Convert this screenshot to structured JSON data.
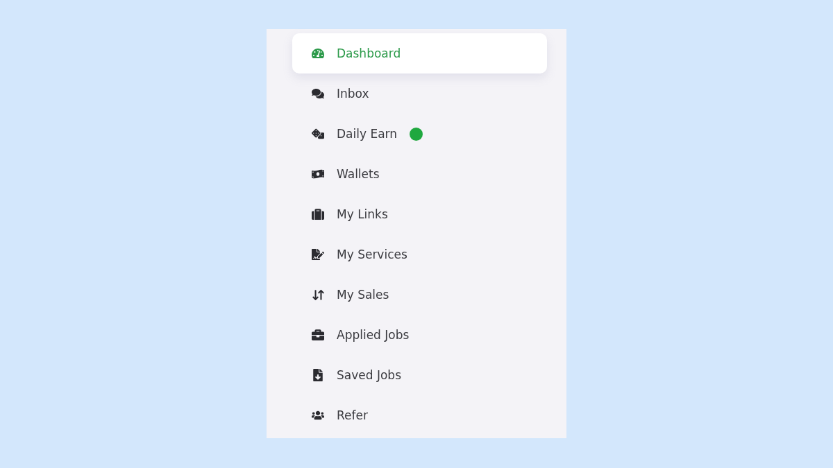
{
  "sidebar": {
    "items": [
      {
        "label": "Dashboard",
        "selected": true
      },
      {
        "label": "Inbox",
        "selected": false
      },
      {
        "label": "Daily Earn",
        "selected": false,
        "color": "#1fa83f"
      },
      {
        "label": "Wallets",
        "selected": false
      },
      {
        "label": "My Links",
        "selected": false
      },
      {
        "label": "My Services",
        "selected": false
      },
      {
        "label": "My Sales",
        "selected": false
      },
      {
        "label": "Applied Jobs",
        "selected": false
      },
      {
        "label": "Saved Jobs",
        "selected": false
      },
      {
        "label": "Refer",
        "selected": false
      }
    ]
  }
}
